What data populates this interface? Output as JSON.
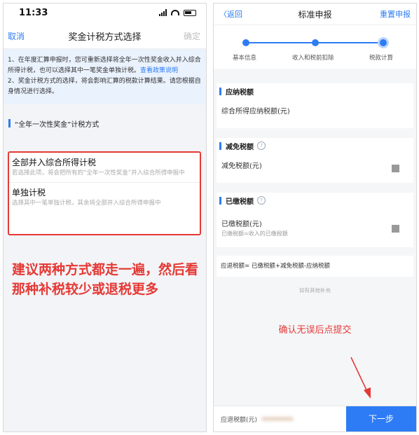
{
  "left": {
    "status": {
      "time": "11:33"
    },
    "nav": {
      "cancel": "取消",
      "title": "奖金计税方式选择",
      "confirm": "确定"
    },
    "notice": {
      "line1": "1、在年度汇算申报时，您可重新选择将全年一次性奖金收入并入综合所得计税，也可以选择其中一笔奖金单独计税。",
      "link": "查看政策说明",
      "line2": "2、奖金计税方式的选择，将会影响汇算的税款计算结果。请您根据自身情况进行选择。"
    },
    "section_title": "“全年一次性奖金”计税方式",
    "options": [
      {
        "title": "全部并入综合所得计税",
        "desc": "若选择此项，将会把所有的“全年一次性奖金”并入综合所得申报中"
      },
      {
        "title": "单独计税",
        "desc": "选择其中一笔单独计税，其余将全部并入综合所得申报中"
      }
    ],
    "advice": "建议两种方式都走一遍，然后看那种补税较少或退税更多"
  },
  "right": {
    "nav": {
      "back": "返回",
      "title": "标准申报",
      "reset": "重置申报"
    },
    "steps": [
      "基本信息",
      "收入和税前扣除",
      "税款计算"
    ],
    "cards": [
      {
        "title": "应纳税额",
        "row": "综合所得应纳税额(元)"
      },
      {
        "title": "减免税额",
        "row": "减免税额(元)"
      },
      {
        "title": "已缴税额",
        "row": "已缴税额(元)",
        "sub": "已缴税额=收入的已缴税额"
      }
    ],
    "formula": "应退税额= 已缴税额+减免税额-应纳税额",
    "more": "如有其他补充",
    "confirm_note": "确认无误后点提交",
    "bottom": {
      "label": "应退税额(元)",
      "next": "下一步"
    }
  },
  "colors": {
    "accent": "#2d7cf6",
    "annotation_red": "#e53935"
  }
}
